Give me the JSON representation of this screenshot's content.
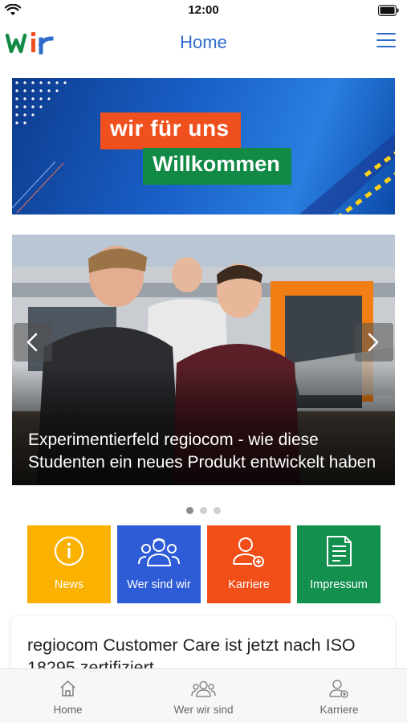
{
  "status_bar": {
    "time": "12:00",
    "wifi_icon": "wifi-icon",
    "battery_icon": "battery-icon"
  },
  "header": {
    "logo_text": "wir",
    "title": "Home",
    "menu_icon": "hamburger-menu-icon",
    "brand_colors": {
      "green": "#128a46",
      "orange": "#f0501d",
      "blue": "#2d6bcb"
    }
  },
  "banner": {
    "line1": "wir für uns",
    "line2": "Willkommen",
    "line1_color": "#f0501d",
    "line2_color": "#128a46"
  },
  "carousel": {
    "caption": "Experimentierfeld regiocom - wie diese Studenten ein neues Produkt entwickelt haben",
    "prev_icon": "chevron-left-icon",
    "next_icon": "chevron-right-icon",
    "slide_count": 3,
    "active_slide": 1
  },
  "tiles": [
    {
      "label": "News",
      "icon": "info-icon",
      "color": "#fbb100"
    },
    {
      "label": "Wer sind wir",
      "icon": "team-icon",
      "color": "#2e5bd6"
    },
    {
      "label": "Karriere",
      "icon": "career-icon",
      "color": "#f24e18"
    },
    {
      "label": "Impressum",
      "icon": "document-icon",
      "color": "#13904e"
    }
  ],
  "news_card": {
    "title": "regiocom Customer Care ist jetzt nach ISO 18295 zertifiziert"
  },
  "tabbar": {
    "tabs": [
      {
        "label": "Home",
        "icon": "home-icon"
      },
      {
        "label": "Wer wir sind",
        "icon": "team-icon"
      },
      {
        "label": "Karriere",
        "icon": "career-icon"
      }
    ]
  }
}
